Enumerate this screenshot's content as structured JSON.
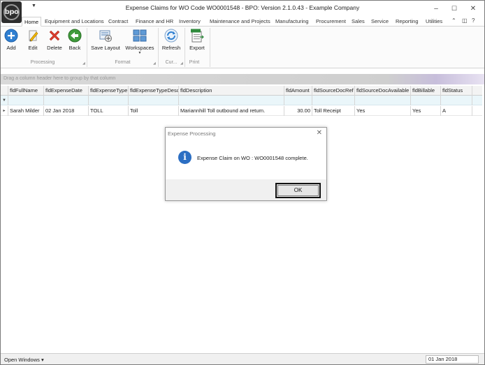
{
  "app": {
    "logo_text": "bpo",
    "title": "Expense Claims for WO Code WO0001548 - BPO: Version 2.1.0.43 - Example Company"
  },
  "window_controls": {
    "minimize": "–",
    "maximize": "☐",
    "close": "✕"
  },
  "tabs": [
    {
      "label": "Home",
      "active": true
    },
    {
      "label": "Equipment and Locations"
    },
    {
      "label": "Contract"
    },
    {
      "label": "Finance and HR"
    },
    {
      "label": "Inventory"
    },
    {
      "label": "Maintenance and Projects"
    },
    {
      "label": "Manufacturing"
    },
    {
      "label": "Procurement"
    },
    {
      "label": "Sales"
    },
    {
      "label": "Service"
    },
    {
      "label": "Reporting"
    },
    {
      "label": "Utilities"
    }
  ],
  "ribbon": {
    "buttons": {
      "add": "Add",
      "edit": "Edit",
      "delete": "Delete",
      "back": "Back",
      "save_layout": "Save Layout",
      "workspaces": "Workspaces",
      "refresh": "Refresh",
      "export": "Export"
    },
    "groups": {
      "processing": "Processing",
      "format": "Format",
      "current": "Cur...",
      "print": "Print"
    },
    "icons": {
      "add": "plus-circle-icon",
      "edit": "pencil-icon",
      "delete": "x-icon",
      "back": "back-arrow-icon",
      "save_layout": "save-layout-icon",
      "workspaces": "grid-icon",
      "refresh": "refresh-icon",
      "export": "excel-export-icon"
    }
  },
  "group_panel": {
    "placeholder": "Drag a column header here to group by that column"
  },
  "grid": {
    "columns": [
      "fldFullName",
      "fldExpenseDate",
      "fldExpenseType",
      "fldExpenseTypeDesc",
      "fldDescription",
      "fldAmount",
      "fldSourceDocRef",
      "fldSourceDocAvailable",
      "fldBillable",
      "fldStatus"
    ],
    "filter_icon": "filter-icon",
    "rows": [
      {
        "fldFullName": "Sarah Milder",
        "fldExpenseDate": "02 Jan 2018",
        "fldExpenseType": "TOLL",
        "fldExpenseTypeDesc": "Toll",
        "fldDescription": "Mariannhill Toll outbound and return.",
        "fldAmount": "30.00",
        "fldSourceDocRef": "Toll Receipt",
        "fldSourceDocAvailable": "Yes",
        "fldBillable": "Yes",
        "fldStatus": "A"
      }
    ]
  },
  "dialog": {
    "title": "Expense Processing",
    "message": "Expense Claim on WO : WO0001548 complete.",
    "icon": "info-icon",
    "ok_label": "OK"
  },
  "statusbar": {
    "open_windows": "Open Windows ▾",
    "date": "01 Jan 2018"
  },
  "colors": {
    "info_blue": "#2b6ec3",
    "add_blue": "#2f7fd1",
    "delete_red": "#d83b2b",
    "back_green": "#3f9b3b"
  }
}
